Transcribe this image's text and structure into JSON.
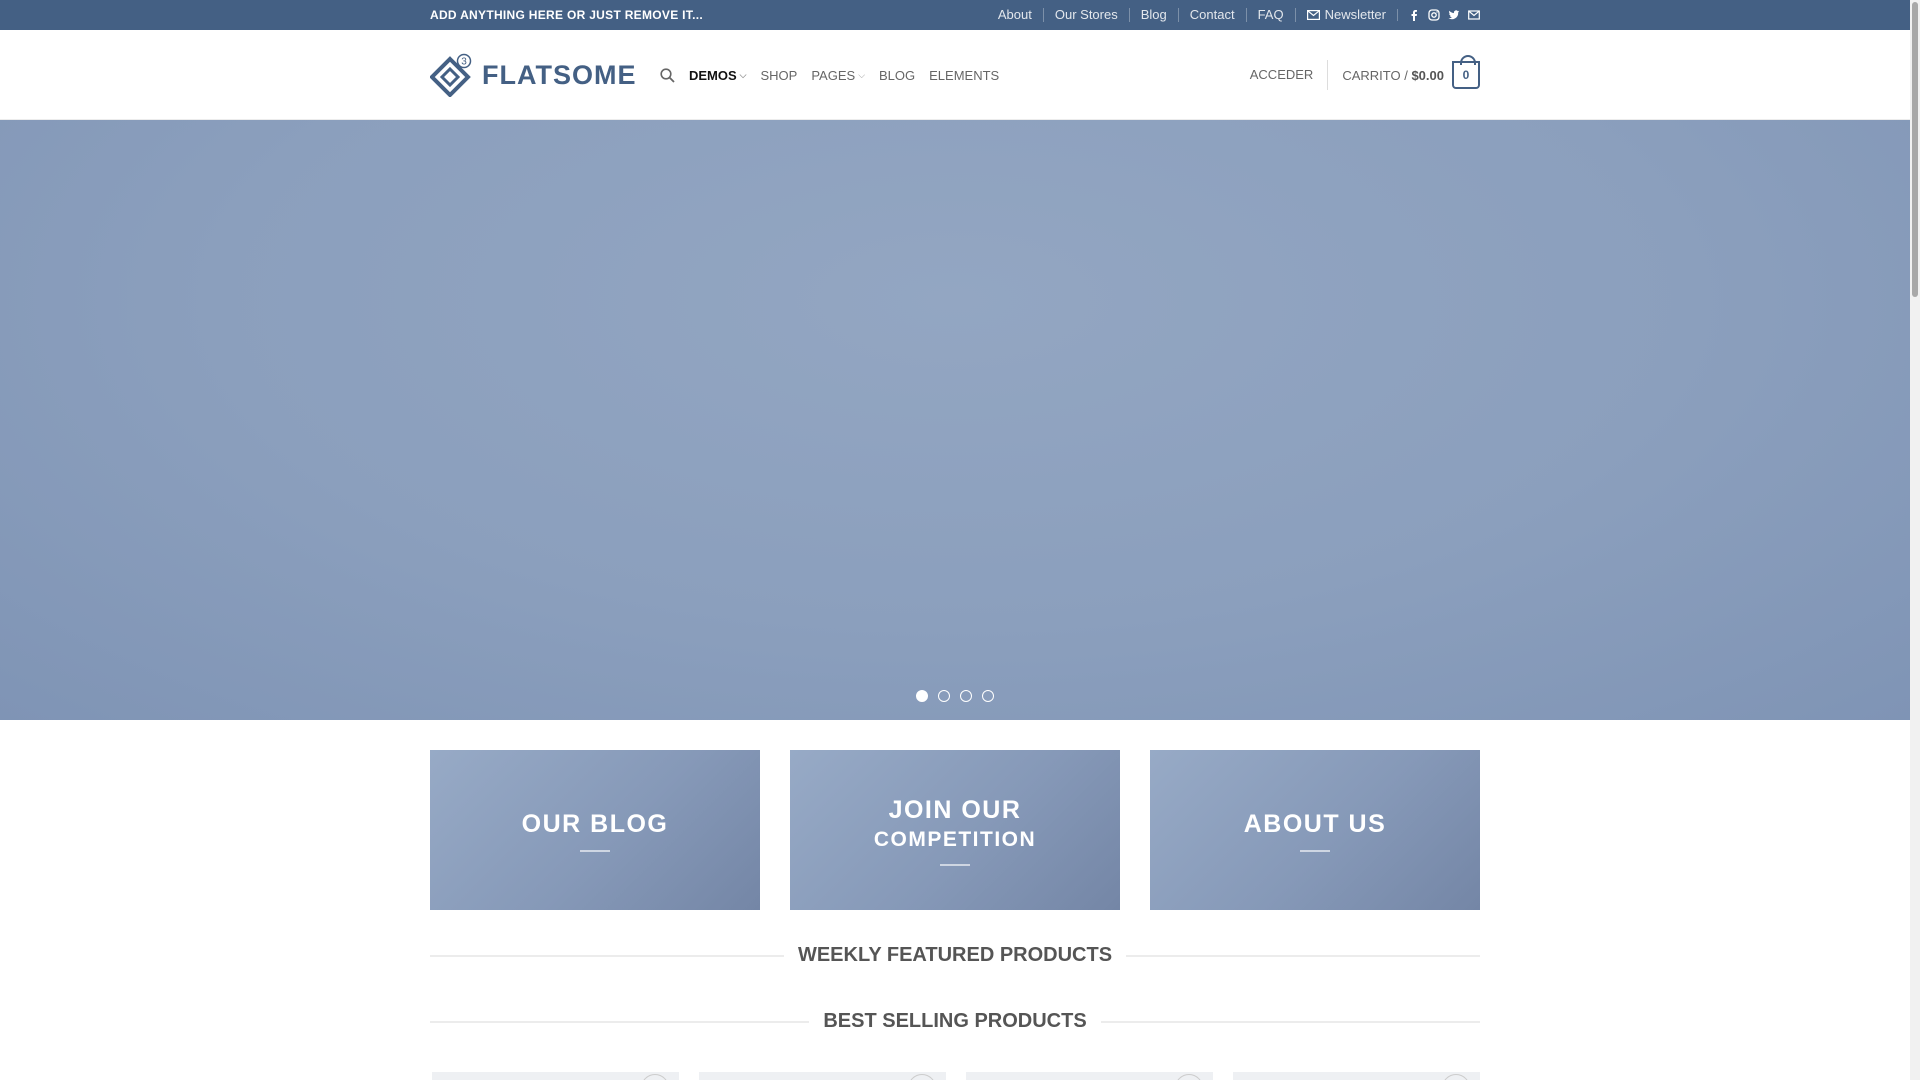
{
  "topbar": {
    "promo_text": "ADD ANYTHING HERE OR JUST REMOVE IT...",
    "links": [
      "About",
      "Our Stores",
      "Blog",
      "Contact",
      "FAQ"
    ],
    "newsletter_label": "Newsletter",
    "social_icons": [
      "facebook-icon",
      "instagram-icon",
      "twitter-icon",
      "email-icon"
    ]
  },
  "header": {
    "logo_text": "FLATSOME",
    "logo_badge": "3",
    "nav": [
      {
        "label": "DEMOS",
        "dropdown": true,
        "active": true
      },
      {
        "label": "SHOP",
        "dropdown": false
      },
      {
        "label": "PAGES",
        "dropdown": true
      },
      {
        "label": "BLOG",
        "dropdown": false
      },
      {
        "label": "ELEMENTS",
        "dropdown": false
      }
    ],
    "login_label": "ACCEDER",
    "cart_label": "CARRITO /",
    "cart_total": "$0.00",
    "cart_count": "0"
  },
  "hero": {
    "slide_count": 4,
    "active_slide": 1
  },
  "banners": [
    {
      "title": "OUR BLOG",
      "subtitle": ""
    },
    {
      "title": "JOIN OUR",
      "subtitle": "COMPETITION"
    },
    {
      "title": "ABOUT US",
      "subtitle": ""
    }
  ],
  "sections": {
    "featured_title": "WEEKLY FEATURED PRODUCTS",
    "bestselling_title": "BEST SELLING PRODUCTS"
  },
  "colors": {
    "primary": "#446084",
    "hero": "#8b9fbd",
    "banner": "#8699b8"
  }
}
